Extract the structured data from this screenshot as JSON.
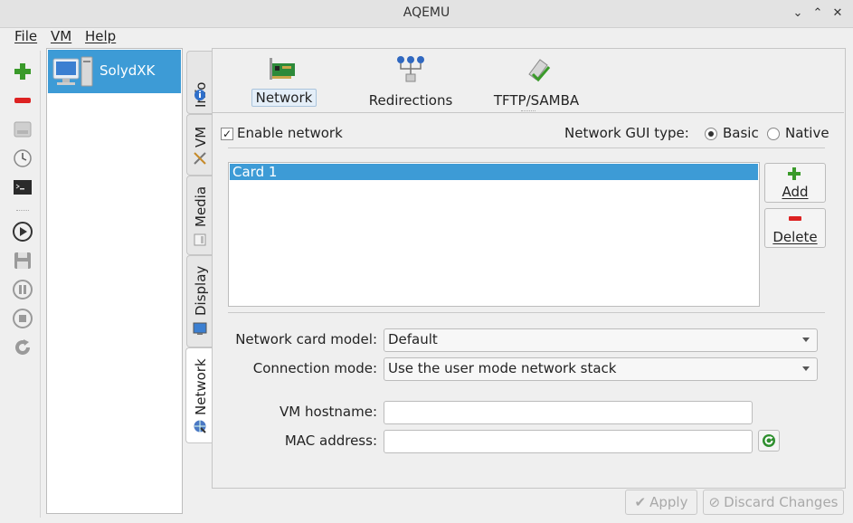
{
  "window": {
    "title": "AQEMU",
    "controls": [
      "⌄",
      "⌃",
      "✕"
    ]
  },
  "menu": [
    {
      "label": "File",
      "mnemonic_index": 0
    },
    {
      "label": "VM",
      "mnemonic_index": 0
    },
    {
      "label": "Help",
      "mnemonic_index": 0
    }
  ],
  "vm_list": {
    "items": [
      {
        "name": "SolydXK",
        "selected": true
      }
    ]
  },
  "vtabs": {
    "info": "Info",
    "vm": "VM",
    "media": "Media",
    "display": "Display",
    "network": "Network",
    "active": "network"
  },
  "subtabs": {
    "network": "Network",
    "redirections": "Redirections",
    "tftp_samba": "TFTP/SAMBA",
    "active": "network"
  },
  "network": {
    "enable_label": "Enable network",
    "enabled": true,
    "gui_type_label": "Network GUI type:",
    "gui_basic": "Basic",
    "gui_native": "Native",
    "gui_selected": "Basic",
    "cards": [
      "Card 1"
    ],
    "add_label": "Add",
    "delete_label": "Delete",
    "card_model_label": "Network card model:",
    "card_model_value": "Default",
    "connection_mode_label": "Connection mode:",
    "connection_mode_value": "Use the user mode network stack",
    "hostname_label": "VM hostname:",
    "hostname_value": "",
    "mac_label": "MAC address:",
    "mac_value": ""
  },
  "footer": {
    "apply": "Apply",
    "discard": "Discard Changes"
  },
  "colors": {
    "selection": "#3d9bd6",
    "accent_green": "#3a9a2a",
    "delete_red": "#d22"
  }
}
